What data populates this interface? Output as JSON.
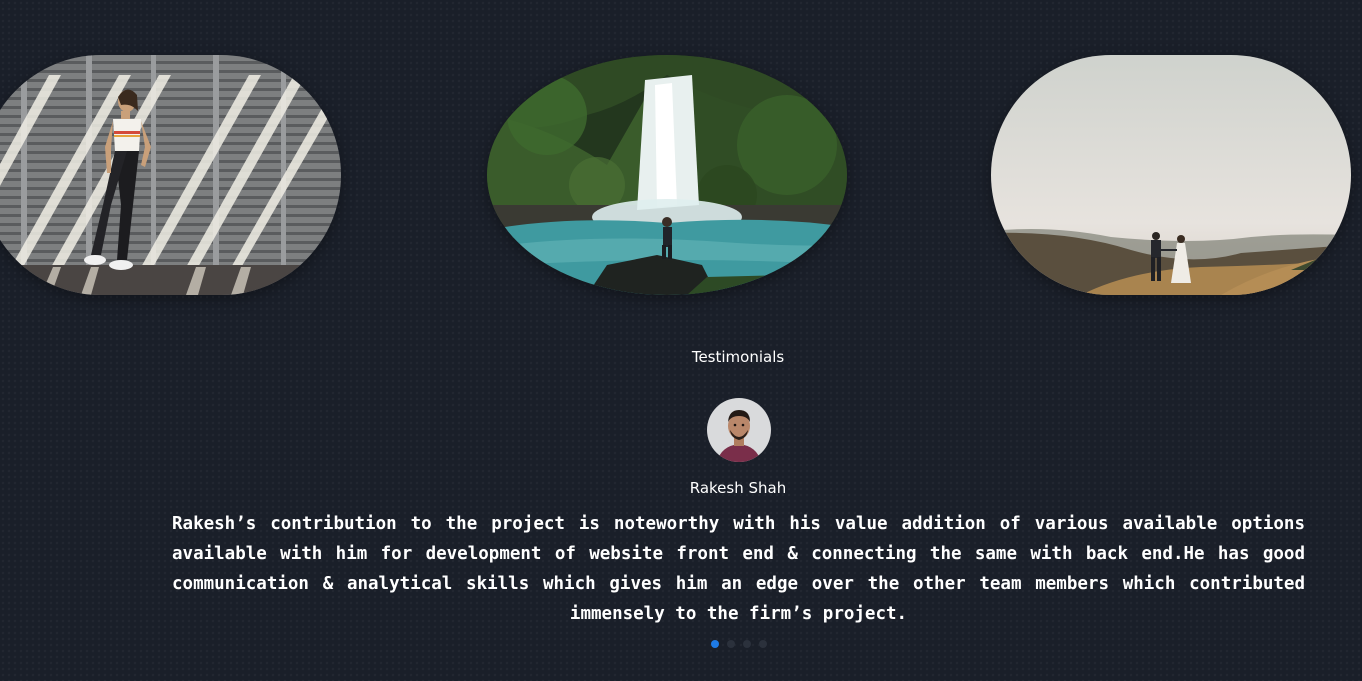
{
  "gallery": {
    "images": [
      {
        "alt": "woman-by-striped-wall-photo"
      },
      {
        "alt": "waterfall-photo"
      },
      {
        "alt": "couple-walking-photo"
      }
    ]
  },
  "testimonials": {
    "title": "Testimonials",
    "author": "Rakesh Shah",
    "quote": "Rakesh’s contribution to the project is noteworthy with his value addition of various available options available with him for development of website front end & connecting the same with back end.He has good communication & analytical skills which gives him an edge over the other team members which contributed immensely to the firm’s project.",
    "carousel": {
      "count": 4,
      "active_index": 0
    },
    "colors": {
      "active_dot": "#1e7be6",
      "inactive_dot": "#2b313c",
      "background": "#1a1f29"
    }
  }
}
